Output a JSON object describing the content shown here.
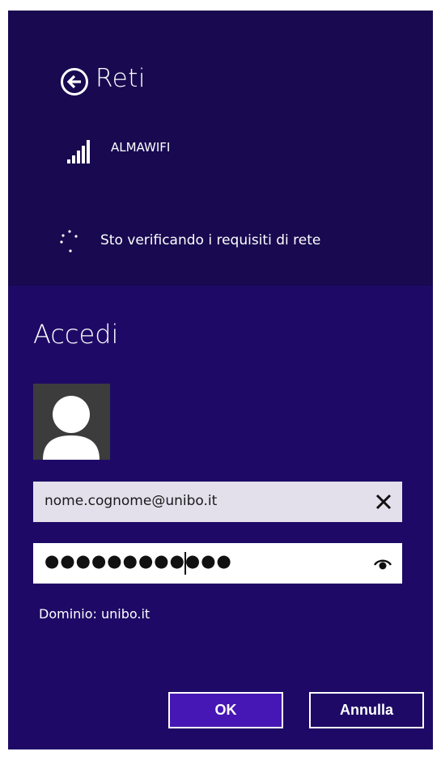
{
  "header": {
    "title": "Reti",
    "back_icon": "back-arrow-circle-icon"
  },
  "network": {
    "name": "ALMAWIFI",
    "signal_icon": "wifi-signal-bars-icon"
  },
  "status": {
    "text": "Sto verificando i requisiti di rete",
    "icon": "progress-spinner-icon"
  },
  "signin": {
    "title": "Accedi",
    "avatar_icon": "user-avatar-icon",
    "username": {
      "value": "nome.cognome@unibo.it",
      "clear_icon": "close-icon"
    },
    "password": {
      "masked_value": "●●●●●●●●●●●●",
      "reveal_icon": "eye-icon"
    },
    "domain": "Dominio: unibo.it"
  },
  "buttons": {
    "ok": "OK",
    "cancel": "Annulla"
  },
  "colors": {
    "panel_bg": "#1e0a66",
    "top_bg": "#180950",
    "ok_bg": "#4617b4",
    "username_field_bg": "#e3e0ec"
  }
}
